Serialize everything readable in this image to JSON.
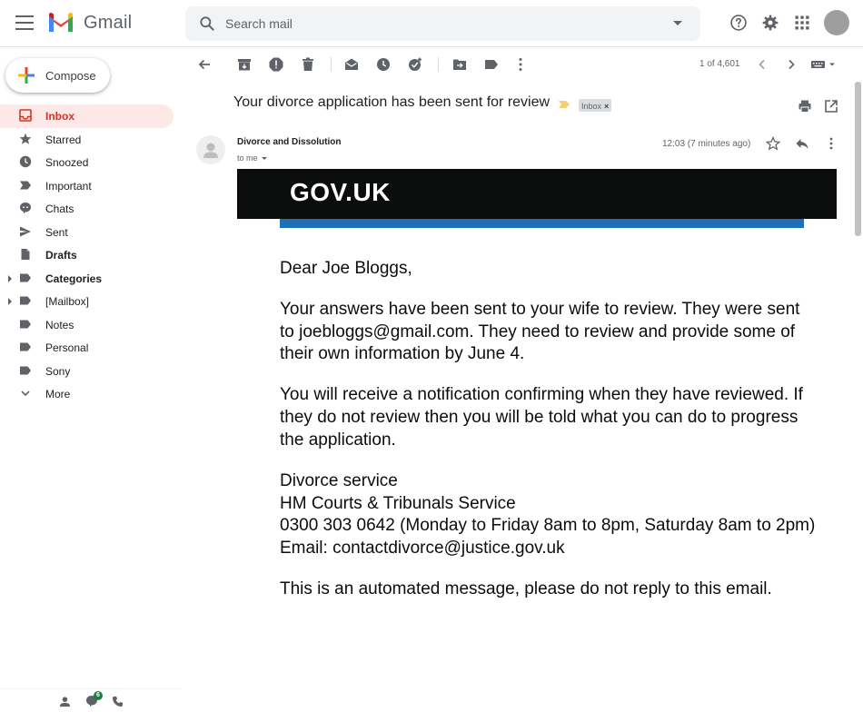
{
  "app": {
    "name": "Gmail",
    "colors": {
      "accent_red": "#d93025",
      "active_bg": "#fce8e6",
      "gov_black": "#0b0c0c",
      "gov_blue": "#1d70b8",
      "chat_badge": "#188038"
    }
  },
  "search": {
    "placeholder": "Search mail"
  },
  "compose": {
    "label": "Compose"
  },
  "sidebar": {
    "items": [
      {
        "label": "Inbox",
        "icon": "inbox-icon"
      },
      {
        "label": "Starred",
        "icon": "star-icon"
      },
      {
        "label": "Snoozed",
        "icon": "clock-icon"
      },
      {
        "label": "Important",
        "icon": "important-icon"
      },
      {
        "label": "Chats",
        "icon": "chat-icon"
      },
      {
        "label": "Sent",
        "icon": "send-icon"
      },
      {
        "label": "Drafts",
        "icon": "draft-icon"
      },
      {
        "label": "Categories",
        "icon": "label-icon"
      },
      {
        "label": "[Mailbox]",
        "icon": "label-icon"
      },
      {
        "label": "Notes",
        "icon": "label-icon"
      },
      {
        "label": "Personal",
        "icon": "label-icon"
      },
      {
        "label": "Sony",
        "icon": "label-icon"
      },
      {
        "label": "More",
        "icon": "chevron-down-icon"
      }
    ],
    "footer": {
      "chat_badge_count": "6"
    }
  },
  "toolbar": {
    "pager": "1 of 4,601"
  },
  "message": {
    "subject": "Your divorce application has been sent for review",
    "label_chip": "Inbox",
    "sender": "Divorce and Dissolution",
    "recipient": "to me",
    "time": "12:03 (7 minutes ago)",
    "banner": "GOV.UK",
    "body": {
      "greeting": "Dear Joe Bloggs,",
      "para1": "Your answers have been sent to your wife to review. They were sent to joebloggs@gmail.com. They need to review and provide some of their own information by June 4.",
      "para2": "You will receive a notification confirming when they have reviewed. If they do not review then you will be told what you can do to progress the application.",
      "sig_line1": "Divorce service",
      "sig_line2": "HM Courts & Tribunals Service",
      "sig_line3": "0300 303 0642 (Monday to Friday 8am to 8pm, Saturday 8am to 2pm)",
      "sig_line4": "Email: contactdivorce@justice.gov.uk",
      "footer": "This is an automated message, please do not reply to this email."
    }
  }
}
